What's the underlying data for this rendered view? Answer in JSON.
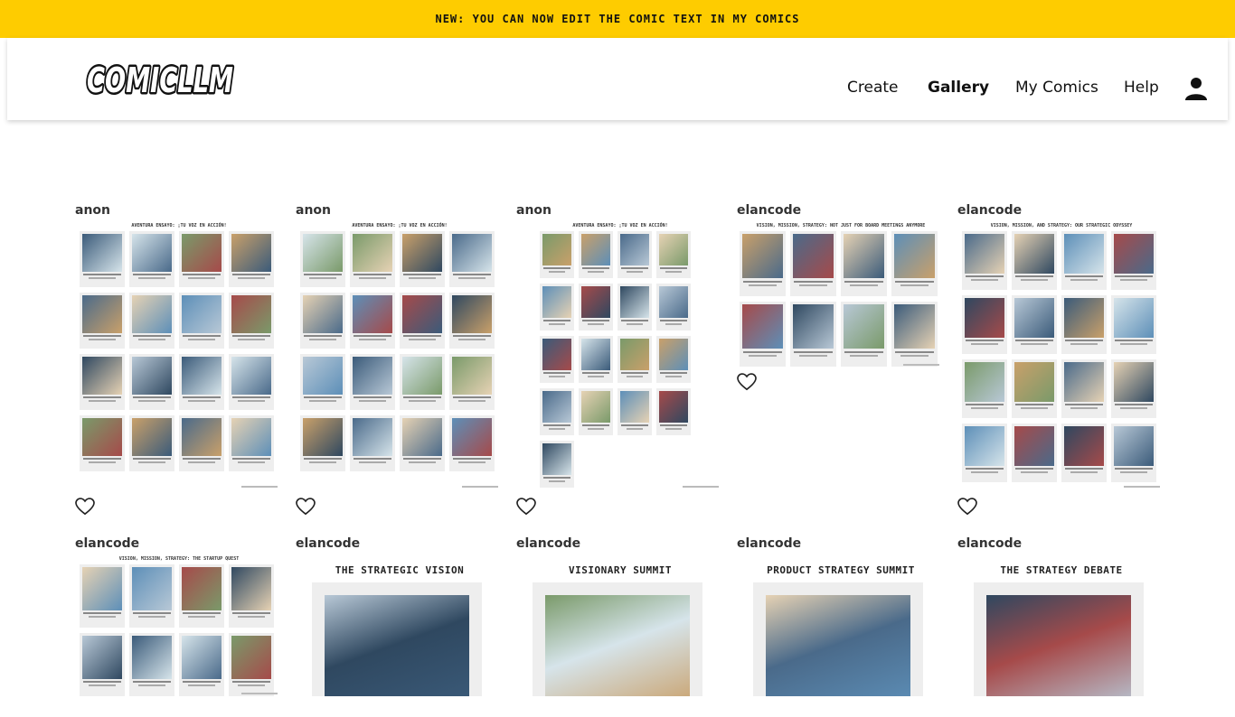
{
  "banner": {
    "text": "NEW: YOU CAN NOW EDIT THE COMIC TEXT IN MY COMICS"
  },
  "header": {
    "logo_text": "COMICLLM",
    "nav": [
      {
        "label": "Create",
        "active": false
      },
      {
        "label": "Gallery",
        "active": true
      },
      {
        "label": "My Comics",
        "active": false
      },
      {
        "label": "Help",
        "active": false
      }
    ],
    "user_icon": "person-icon"
  },
  "gallery": {
    "cards": [
      {
        "author": "anon",
        "title": "AVENTURA ENSAYO: ¡TU VOZ EN ACCIÓN!",
        "kind": "grid",
        "favorite_icon": "heart-outline-icon"
      },
      {
        "author": "anon",
        "title": "AVENTURA ENSAYO: ¡TU VOZ EN ACCIÓN!",
        "kind": "grid",
        "favorite_icon": "heart-outline-icon"
      },
      {
        "author": "anon",
        "title": "AVENTURA ENSAYO: ¡TU VOZ EN ACCIÓN!",
        "kind": "grid",
        "favorite_icon": "heart-outline-icon"
      },
      {
        "author": "elancode",
        "title": "VISION, MISSION, STRATEGY: NOT JUST FOR BOARD MEETINGS ANYMORE",
        "kind": "grid",
        "favorite_icon": "heart-outline-icon"
      },
      {
        "author": "elancode",
        "title": "VISION, MISSION, AND STRATEGY: OUR STRATEGIC ODYSSEY",
        "kind": "grid",
        "favorite_icon": "heart-outline-icon"
      },
      {
        "author": "elancode",
        "title": "VISION, MISSION, STRATEGY: THE STARTUP QUEST",
        "kind": "grid"
      },
      {
        "author": "elancode",
        "title": "THE STRATEGIC VISION",
        "kind": "single"
      },
      {
        "author": "elancode",
        "title": "VISIONARY SUMMIT",
        "kind": "single"
      },
      {
        "author": "elancode",
        "title": "PRODUCT STRATEGY SUMMIT",
        "kind": "single"
      },
      {
        "author": "elancode",
        "title": "THE STRATEGY DEBATE",
        "kind": "single"
      }
    ]
  },
  "colors": {
    "banner": "#fecc00",
    "text": "#111111"
  }
}
